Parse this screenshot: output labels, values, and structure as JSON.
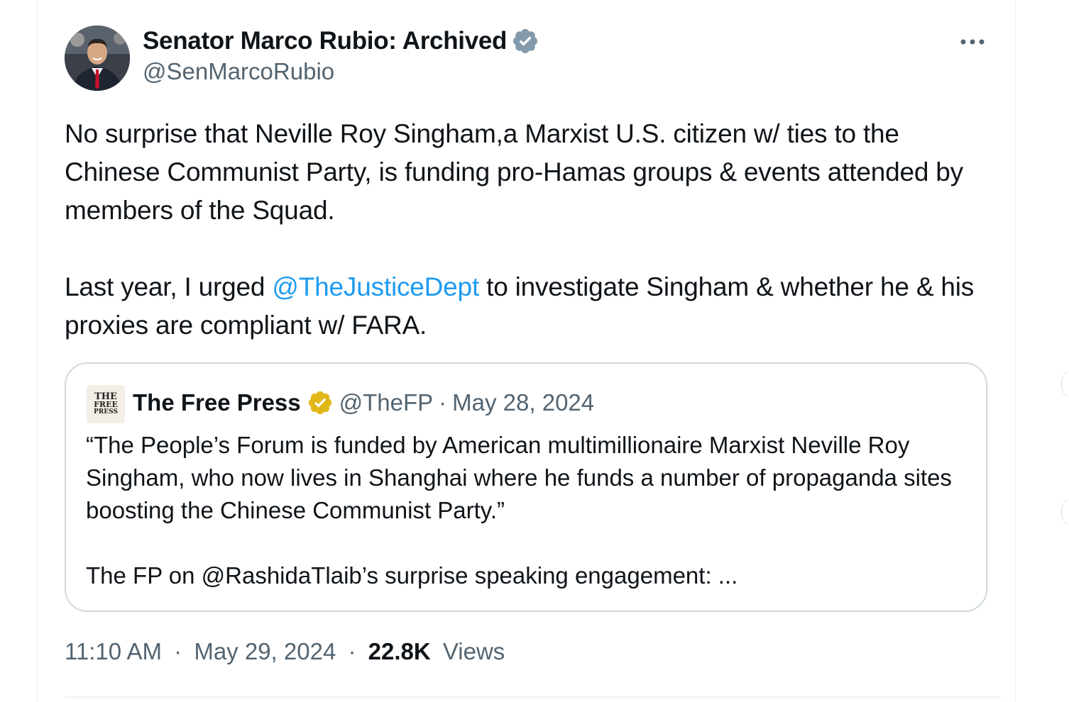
{
  "tweet": {
    "author": {
      "display_name": "Senator Marco Rubio: Archived",
      "handle": "@SenMarcoRubio",
      "verified_badge": "verified-gray"
    },
    "more_icon": "more-horizontal-icon",
    "text": {
      "paragraph1": "No surprise that Neville Roy Singham,a Marxist U.S. citizen w/ ties to the Chinese Communist Party, is funding pro-Hamas groups & events attended by members of the Squad.",
      "paragraph2_before": "Last year, I urged ",
      "paragraph2_mention": "@TheJusticeDept",
      "paragraph2_after": " to investigate Singham & whether he & his proxies are compliant w/ FARA."
    },
    "quote": {
      "logo_line1": "THE",
      "logo_line2": "FREE",
      "logo_line3": "PRESS",
      "display_name": "The Free Press",
      "verified_badge": "verified-gold",
      "handle": "@TheFP",
      "separator": "·",
      "date": "May 28, 2024",
      "paragraph1": "“The People’s Forum is funded by American multimillionaire Marxist Neville Roy Singham, who now lives in Shanghai where he funds a number of propaganda sites boosting the Chinese Communist Party.”",
      "paragraph2": "The FP on @RashidaTlaib’s surprise speaking engagement: ..."
    },
    "meta": {
      "time": "11:10 AM",
      "separator": "·",
      "date": "May 29, 2024",
      "views_count": "22.8K",
      "views_label": "Views"
    }
  },
  "colors": {
    "text_primary": "#0f1419",
    "text_secondary": "#536471",
    "link": "#1d9bf0",
    "border": "#cfd9de",
    "verified_gray": "#829aab",
    "verified_gold": "#e2b719"
  }
}
